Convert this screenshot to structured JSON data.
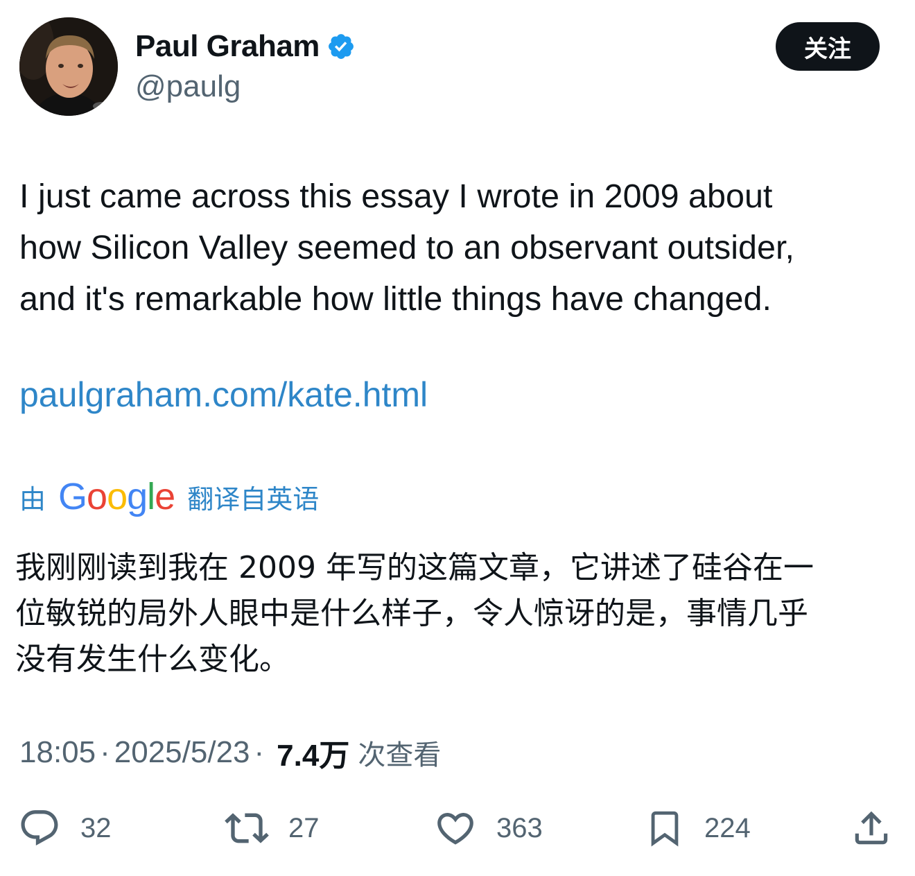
{
  "author": {
    "name": "Paul Graham",
    "handle": "@paulg",
    "verified": true,
    "follow_label": "关注"
  },
  "tweet": {
    "text_lines": [
      "I just came across this essay I wrote in 2009 about",
      "how Silicon Valley seemed to an observant outsider,",
      "and it's remarkable how little things have changed."
    ],
    "link": "paulgraham.com/kate.html"
  },
  "translation": {
    "prefix": "由",
    "provider": "Google",
    "suffix": "翻译自英语",
    "text_lines": [
      "我刚刚读到我在 2009 年写的这篇文章，它讲述了硅谷在一",
      "位敏锐的局外人眼中是什么样子，令人惊讶的是，事情几乎",
      "没有发生什么变化。"
    ]
  },
  "meta": {
    "time": "18:05",
    "separator": "·",
    "date": "2025/5/23",
    "views": "7.4万",
    "views_label": "次查看"
  },
  "actions": {
    "replies": "32",
    "reposts": "27",
    "likes": "363",
    "bookmarks": "224"
  },
  "colors": {
    "text": "#0f1419",
    "secondary": "#536471",
    "link": "#2e86c8",
    "verified": "#1d9bf0",
    "follow_bg": "#0f1419"
  }
}
